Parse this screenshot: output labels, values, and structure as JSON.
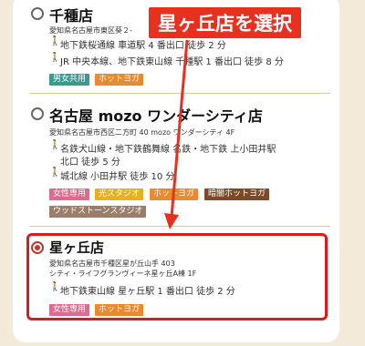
{
  "stores": [
    {
      "name": "千種店",
      "address": "愛知県名古屋市東区葵２-",
      "access": [
        "地下鉄桜通線 車道駅 4 番出口 徒歩 2 分",
        "JR 中央本線、地下鉄東山線 千種駅 1 番出口 徒歩 8 分"
      ],
      "tags": [
        "男女共用",
        "ホットヨガ"
      ],
      "selected": false
    },
    {
      "name": "名古屋 mozo ワンダーシティ店",
      "address": "愛知県名古屋市西区二方町 40 mozo ワンダーシティ 4F",
      "access": [
        "名鉄犬山線・地下鉄鶴舞線 名鉄・地下鉄 上小田井駅",
        "北口 徒歩 5 分",
        "城北線 小田井駅 徒歩 10 分"
      ],
      "tags": [
        "女性専用",
        "光スタジオ",
        "ホットヨガ",
        "暗闇ホットヨガ",
        "ウッドストーンスタジオ"
      ],
      "selected": false
    },
    {
      "name": "星ヶ丘店",
      "address": [
        "愛知県名古屋市千種区星が丘山手 403",
        "シティ・ライフグランヴィーネ星ヶ丘A棟 1F"
      ],
      "access": [
        "地下鉄東山線 星ヶ丘駅 1 番出口 徒歩 2 分"
      ],
      "tags": [
        "女性専用",
        "ホットヨガ"
      ],
      "selected": true
    }
  ],
  "annotation": {
    "text": "星ヶ丘店を選択"
  },
  "colors": {
    "tag_teal": "#3a9a8e",
    "tag_orange": "#e88a2e",
    "tag_pink": "#e06a8e",
    "tag_yellow": "#e8b020",
    "tag_brown": "#7a4a2a",
    "tag_gray": "#9a7e6a",
    "callout_red": "#e8301f",
    "walk_icon": "#e08a1c"
  }
}
